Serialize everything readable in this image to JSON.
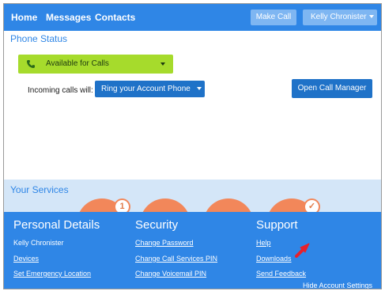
{
  "nav": {
    "links": [
      "Home",
      "Messages",
      "Contacts"
    ],
    "make_call": "Make Call",
    "user_name": "Kelly Chronister"
  },
  "phone_status": {
    "title": "Phone Status",
    "status_value": "Available for Calls",
    "incoming_label": "Incoming calls will:",
    "incoming_value": "Ring your Account Phone",
    "call_manager": "Open Call Manager"
  },
  "services": {
    "title": "Your Services",
    "badges": [
      "1",
      "✓"
    ]
  },
  "account": {
    "personal": {
      "title": "Personal Details",
      "name": "Kelly Chronister",
      "items": [
        "Devices",
        "Set Emergency Location"
      ]
    },
    "security": {
      "title": "Security",
      "items": [
        "Change Password",
        "Change Call Services PIN",
        "Change Voicemail PIN"
      ]
    },
    "support": {
      "title": "Support",
      "items": [
        "Help",
        "Downloads",
        "Send Feedback"
      ]
    },
    "hide_settings": "Hide Account Settings"
  },
  "colors": {
    "brand_blue": "#2f86e6",
    "dark_blue": "#1f72c8",
    "status_green": "#a6db2c",
    "service_orange": "#f2875a",
    "services_bg": "#d4e6f8",
    "arrow_red": "#e8202a"
  },
  "icons": [
    "phone-icon",
    "caret-down-icon",
    "red-arrow-icon"
  ]
}
